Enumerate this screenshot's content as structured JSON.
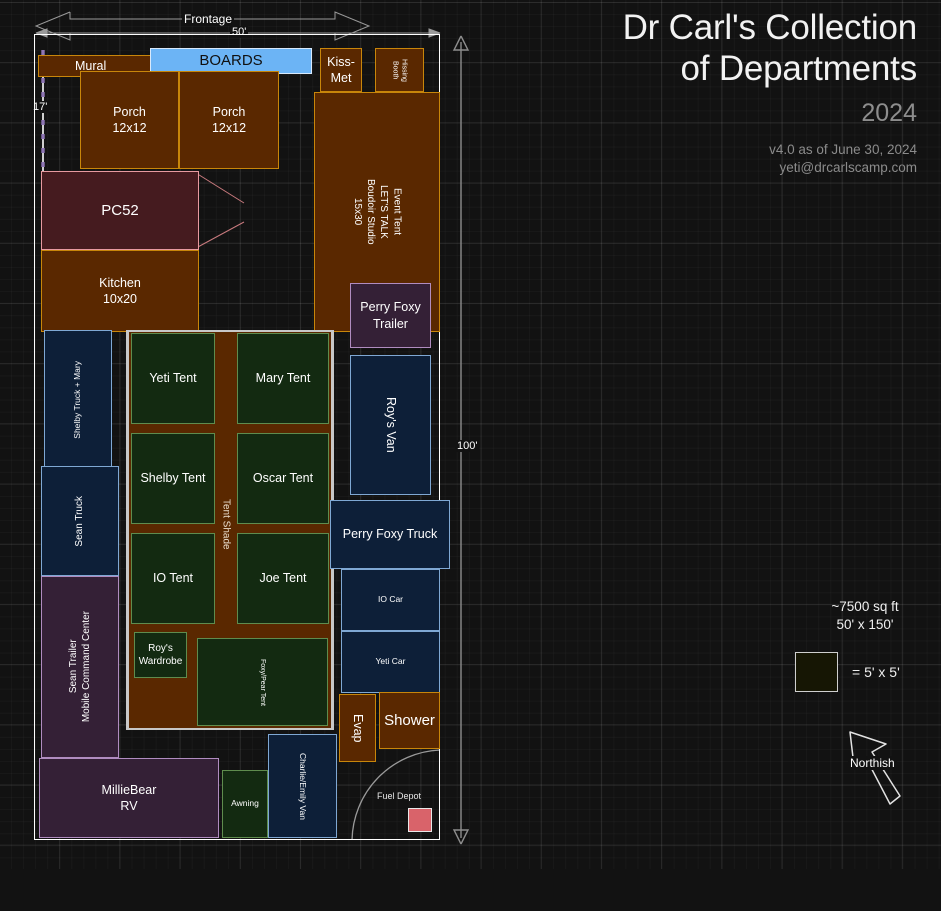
{
  "header": {
    "title": "Dr Carl's Collection\nof Departments",
    "year": "2024",
    "version": "v4.0 as of June 30, 2024",
    "email": "yeti@drcarlscamp.com"
  },
  "dimensions": {
    "frontage_label": "Frontage",
    "frontage_value": "50'",
    "left_height": "17'",
    "site_depth": "100'"
  },
  "legend": {
    "area": "~7500 sq ft",
    "lot": "50' x 150'",
    "scale_equals": "= 5' x 5'",
    "swatch_color": "#161604"
  },
  "compass": {
    "label": "Northish"
  },
  "colors": {
    "background": "#121212",
    "brown": "#5a2800",
    "brown_border": "#c8860a",
    "green": "#132a11",
    "green_border": "#5f8c4e",
    "navy": "#0d1f38",
    "navy_border": "#7fa8d4",
    "purple": "#342036",
    "purple_border": "#b08cc0",
    "maroon": "#451b1f",
    "maroon_border": "#e79aa0",
    "boards_blue": "#6cb4f5",
    "fuel_red": "#d9636a",
    "outline_white": "#ffffff"
  },
  "plan": {
    "mural": "Mural",
    "boards": "BOARDS",
    "porch_left": "Porch\n12x12",
    "porch_right": "Porch\n12x12",
    "kiss_met": "Kiss-\nMet",
    "hissing_booth": "Hissing Booth",
    "event_tent": "Event Tent\nLET'S TALK\nBoudoir Studio\n15x30",
    "pc52": "PC52",
    "kitchen": "Kitchen\n10x20",
    "perry_foxy_trailer": "Perry Foxy\nTrailer",
    "roys_van": "Roy's Van",
    "perry_foxy_truck": "Perry Foxy Truck",
    "io_car": "IO Car",
    "yeti_car": "Yeti Car",
    "shelby_truck_mary": "Shelby Truck + Mary",
    "sean_truck": "Sean Truck",
    "sean_trailer": "Sean Trailer\nMobile Command Center",
    "yeti_tent": "Yeti Tent",
    "mary_tent": "Mary Tent",
    "shelby_tent": "Shelby Tent",
    "oscar_tent": "Oscar Tent",
    "io_tent": "IO Tent",
    "joe_tent": "Joe Tent",
    "tent_shade": "Tent Shade",
    "roys_wardrobe": "Roy's\nWardrobe",
    "foxy_pear_tent": "Foxy/Pear Tent",
    "milliebear_rv": "MillieBear\nRV",
    "awning": "Awning",
    "charlie_emily_van": "Charlie/Emily Van",
    "evap": "Evap",
    "shower": "Shower",
    "fuel_depot": "Fuel Depot"
  }
}
